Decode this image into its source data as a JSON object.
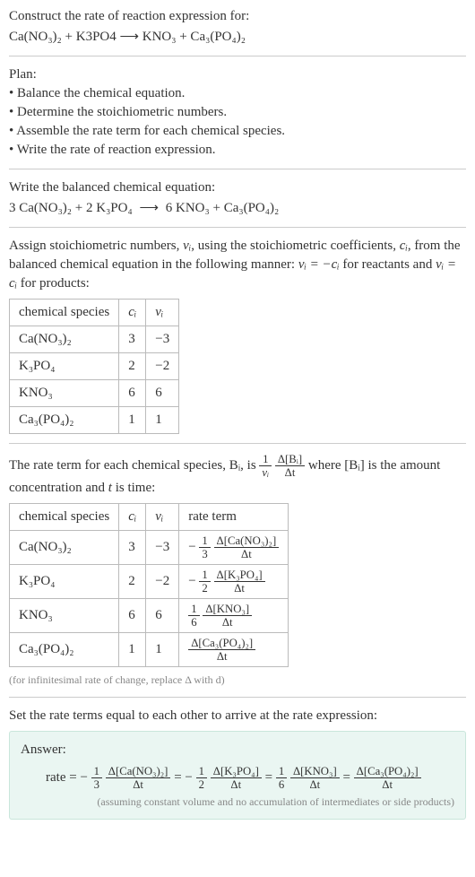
{
  "header": {
    "construct": "Construct the rate of reaction expression for:",
    "unbalanced": "Ca(NO₃)₂ + K3PO4  ⟶  KNO₃ + Ca₃(PO₄)₂"
  },
  "plan": {
    "title": "Plan:",
    "items": [
      "Balance the chemical equation.",
      "Determine the stoichiometric numbers.",
      "Assemble the rate term for each chemical species.",
      "Write the rate of reaction expression."
    ]
  },
  "balanced": {
    "title": "Write the balanced chemical equation:",
    "eq_lhs1": "3 Ca(NO₃)₂",
    "eq_lhs2": "2 K₃PO₄",
    "eq_rhs1": "6 KNO₃",
    "eq_rhs2": "Ca₃(PO₄)₂"
  },
  "stoich": {
    "intro_a": "Assign stoichiometric numbers, ",
    "intro_b": ", using the stoichiometric coefficients, ",
    "intro_c": ", from the balanced chemical equation in the following manner: ",
    "intro_d": " for reactants and ",
    "intro_e": " for products:",
    "nu": "νᵢ",
    "ci": "cᵢ",
    "rel_react": "νᵢ = −cᵢ",
    "rel_prod": "νᵢ = cᵢ",
    "headers": {
      "species": "chemical species",
      "c": "cᵢ",
      "nu": "νᵢ"
    },
    "rows": [
      {
        "sp": "Ca(NO₃)₂",
        "c": "3",
        "nu": "−3"
      },
      {
        "sp": "K₃PO₄",
        "c": "2",
        "nu": "−2"
      },
      {
        "sp": "KNO₃",
        "c": "6",
        "nu": "6"
      },
      {
        "sp": "Ca₃(PO₄)₂",
        "c": "1",
        "nu": "1"
      }
    ]
  },
  "rate_terms": {
    "intro_a": "The rate term for each chemical species, Bᵢ, is ",
    "intro_b": " where [Bᵢ] is the amount concentration and ",
    "intro_c": " is time:",
    "t": "t",
    "frac1_num": "1",
    "frac1_den": "νᵢ",
    "frac2_num": "Δ[Bᵢ]",
    "frac2_den": "Δt",
    "headers": {
      "species": "chemical species",
      "c": "cᵢ",
      "nu": "νᵢ",
      "rate": "rate term"
    },
    "rows": [
      {
        "sp": "Ca(NO₃)₂",
        "c": "3",
        "nu": "−3",
        "coef_num": "1",
        "coef_den": "3",
        "sign": "−",
        "conc_num": "Δ[Ca(NO₃)₂]",
        "den": "Δt"
      },
      {
        "sp": "K₃PO₄",
        "c": "2",
        "nu": "−2",
        "coef_num": "1",
        "coef_den": "2",
        "sign": "−",
        "conc_num": "Δ[K₃PO₄]",
        "den": "Δt"
      },
      {
        "sp": "KNO₃",
        "c": "6",
        "nu": "6",
        "coef_num": "1",
        "coef_den": "6",
        "sign": "",
        "conc_num": "Δ[KNO₃]",
        "den": "Δt"
      },
      {
        "sp": "Ca₃(PO₄)₂",
        "c": "1",
        "nu": "1",
        "coef_num": "",
        "coef_den": "",
        "sign": "",
        "conc_num": "Δ[Ca₃(PO₄)₂]",
        "den": "Δt"
      }
    ],
    "note": "(for infinitesimal rate of change, replace Δ with d)"
  },
  "final": {
    "intro": "Set the rate terms equal to each other to arrive at the rate expression:",
    "answer_label": "Answer:",
    "rate_label": "rate = ",
    "eq": " = ",
    "terms": [
      {
        "sign": "−",
        "coef_num": "1",
        "coef_den": "3",
        "conc_num": "Δ[Ca(NO₃)₂]",
        "den": "Δt"
      },
      {
        "sign": "−",
        "coef_num": "1",
        "coef_den": "2",
        "conc_num": "Δ[K₃PO₄]",
        "den": "Δt"
      },
      {
        "sign": "",
        "coef_num": "1",
        "coef_den": "6",
        "conc_num": "Δ[KNO₃]",
        "den": "Δt"
      },
      {
        "sign": "",
        "coef_num": "",
        "coef_den": "",
        "conc_num": "Δ[Ca₃(PO₄)₂]",
        "den": "Δt"
      }
    ],
    "note": "(assuming constant volume and no accumulation of intermediates or side products)"
  }
}
